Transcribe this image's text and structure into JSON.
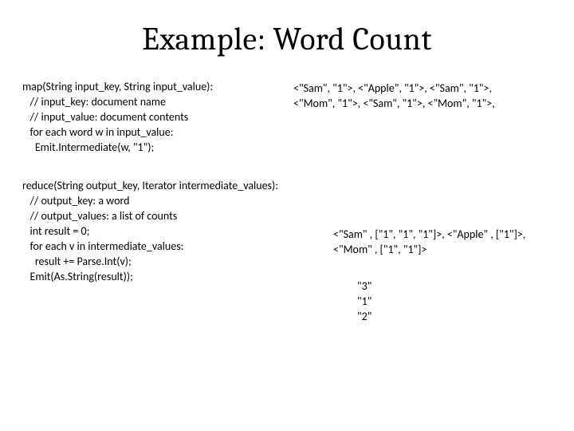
{
  "title": "Example: Word Count",
  "map": {
    "sig": "map(String input_key, String input_value):",
    "c1": "   // input_key: document name",
    "c2": "   // input_value: document contents",
    "c3": "   for each word w in input_value:",
    "c4": "     Emit.Intermediate(w, \"1\");"
  },
  "emitted": {
    "l1": "<\"Sam\", \"1\">, <\"Apple\", \"1\">, <\"Sam\", \"1\">,",
    "l2": "<\"Mom\", \"1\">, <\"Sam\", \"1\">, <\"Mom\", \"1\">,"
  },
  "reduce": {
    "sig": "reduce(String output_key, Iterator intermediate_values):",
    "c1": "   // output_key: a word",
    "c2": "   // output_values: a list of counts",
    "c3": "   int result = 0;",
    "c4": "   for each v in intermediate_values:",
    "c5": "     result += Parse.Int(v);",
    "c6": "   Emit(As.String(result));"
  },
  "grouped": {
    "l1": "<\"Sam\" , [\"1\", \"1\", \"1\"]>, <\"Apple\" , [\"1\"]>,",
    "l2": "<\"Mom\" , [\"1\", \"1\"]>"
  },
  "final": {
    "v1": "\"3\"",
    "v2": "\"1\"",
    "v3": "\"2\""
  }
}
